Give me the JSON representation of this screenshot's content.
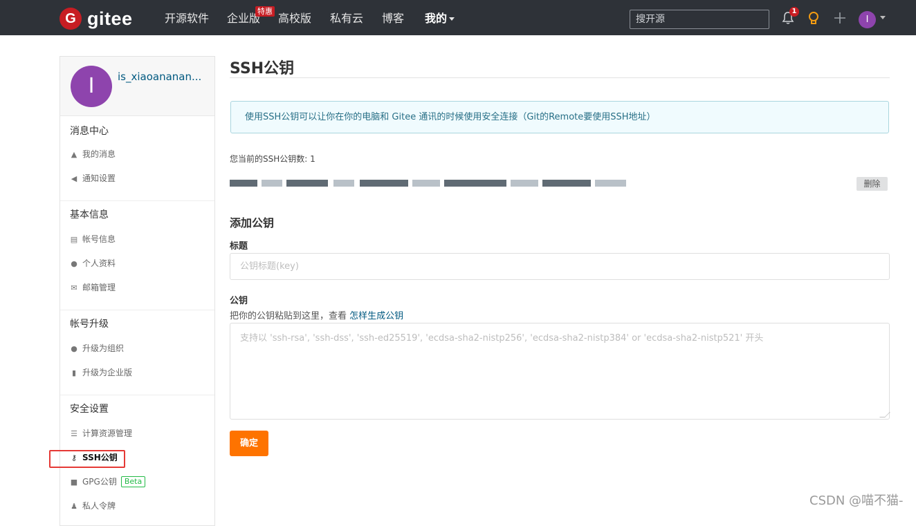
{
  "header": {
    "logo_letter": "G",
    "logo_text": "gitee",
    "nav": [
      {
        "label": "开源软件"
      },
      {
        "label": "企业版",
        "badge": "特惠"
      },
      {
        "label": "高校版"
      },
      {
        "label": "私有云"
      },
      {
        "label": "博客"
      },
      {
        "label": "我的"
      }
    ],
    "search_placeholder": "搜开源",
    "notification_count": "1",
    "avatar_letter": "I"
  },
  "sidebar": {
    "profile": {
      "avatar_letter": "I",
      "username": "is_xiaoananan..."
    },
    "sections": [
      {
        "title": "消息中心",
        "items": [
          "我的消息",
          "通知设置"
        ]
      },
      {
        "title": "基本信息",
        "items": [
          "帐号信息",
          "个人资料",
          "邮箱管理"
        ]
      },
      {
        "title": "帐号升级",
        "items": [
          "升级为组织",
          "升级为企业版"
        ]
      },
      {
        "title": "安全设置",
        "items": [
          "计算资源管理",
          "SSH公钥",
          "GPG公钥",
          "私人令牌"
        ]
      }
    ],
    "beta_label": "Beta"
  },
  "main": {
    "title": "SSH公钥",
    "info": "使用SSH公钥可以让你在你的电脑和 Gitee 通讯的时候使用安全连接（Git的Remote要使用SSH地址）",
    "key_count_text": "您当前的SSH公钥数: 1",
    "delete_label": "删除",
    "add_title": "添加公钥",
    "title_label": "标题",
    "title_placeholder": "公钥标题(key)",
    "key_label": "公钥",
    "hint_text": "把你的公钥粘贴到这里，查看 ",
    "hint_link": "怎样生成公钥",
    "key_placeholder": "支持以 'ssh-rsa', 'ssh-dss', 'ssh-ed25519', 'ecdsa-sha2-nistp256', 'ecdsa-sha2-nistp384' or 'ecdsa-sha2-nistp521' 开头",
    "submit_label": "确定"
  },
  "watermark": "CSDN @喵不猫-",
  "colors": {
    "nav_bg": "#2e3238",
    "brand": "#c71d23",
    "submit": "#fe7300",
    "link": "#005980"
  }
}
